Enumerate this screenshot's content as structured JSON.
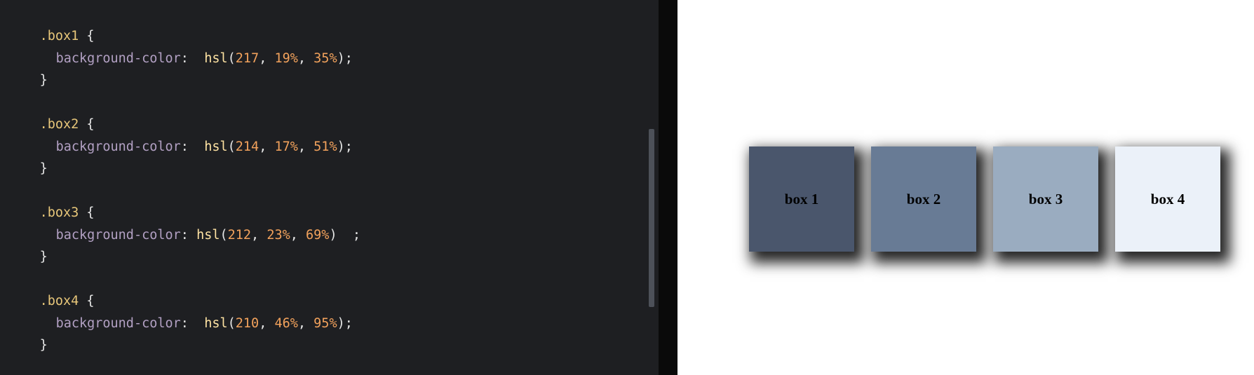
{
  "editor": {
    "lines": [
      {
        "selector": ".box1",
        "open": " {"
      },
      {
        "property": "background-color",
        "sep": ":  ",
        "fn": "hsl",
        "args": [
          "217",
          "19%",
          "35%"
        ],
        "tail": ");"
      },
      {
        "close": "}"
      },
      {
        "selector": ".box2",
        "open": " {"
      },
      {
        "property": "background-color",
        "sep": ":  ",
        "fn": "hsl",
        "args": [
          "214",
          "17%",
          "51%"
        ],
        "tail": ");"
      },
      {
        "close": "}"
      },
      {
        "selector": ".box3",
        "open": " {"
      },
      {
        "property": "background-color",
        "sep": ": ",
        "fn": "hsl",
        "args": [
          "212",
          "23%",
          "69%"
        ],
        "tail": ")  ;"
      },
      {
        "close": "}"
      },
      {
        "selector": ".box4",
        "open": " {"
      },
      {
        "property": "background-color",
        "sep": ":  ",
        "fn": "hsl",
        "args": [
          "210",
          "46%",
          "95%"
        ],
        "tail": ");"
      },
      {
        "close": "}"
      }
    ],
    "fold_icon": "chevron-down-icon"
  },
  "preview": {
    "boxes": [
      {
        "label": "box 1",
        "color": "#4a566c"
      },
      {
        "label": "box 2",
        "color": "#687b95"
      },
      {
        "label": "box 3",
        "color": "#9aacc0"
      },
      {
        "label": "box 4",
        "color": "#ebf1f9"
      }
    ]
  },
  "colors": {
    "editor_bg": "#1e1f22",
    "selector": "#e8c77a",
    "property": "#b3a1c4",
    "function": "#ffe3a3",
    "number": "#f2a25c"
  }
}
